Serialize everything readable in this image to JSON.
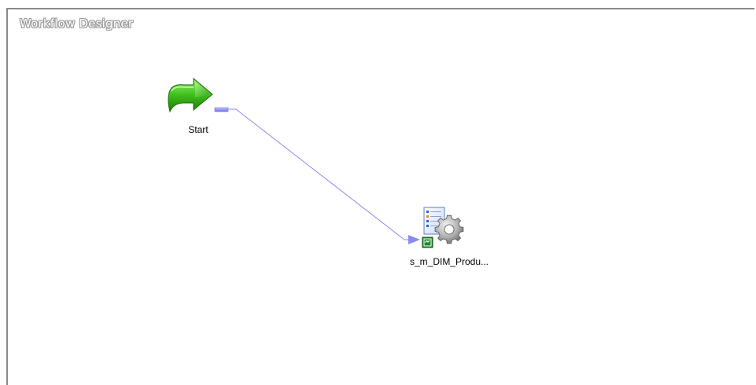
{
  "designer": {
    "title": "Workflow Designer"
  },
  "tasks": {
    "start": {
      "label": "Start",
      "icon": "green-arrow-icon"
    },
    "session": {
      "label": "s_m_DIM_Produ...",
      "icon": "session-gear-icon"
    }
  },
  "link": {
    "from": "Start",
    "to": "s_m_DIM_Produ...",
    "color": "#8080f0"
  }
}
